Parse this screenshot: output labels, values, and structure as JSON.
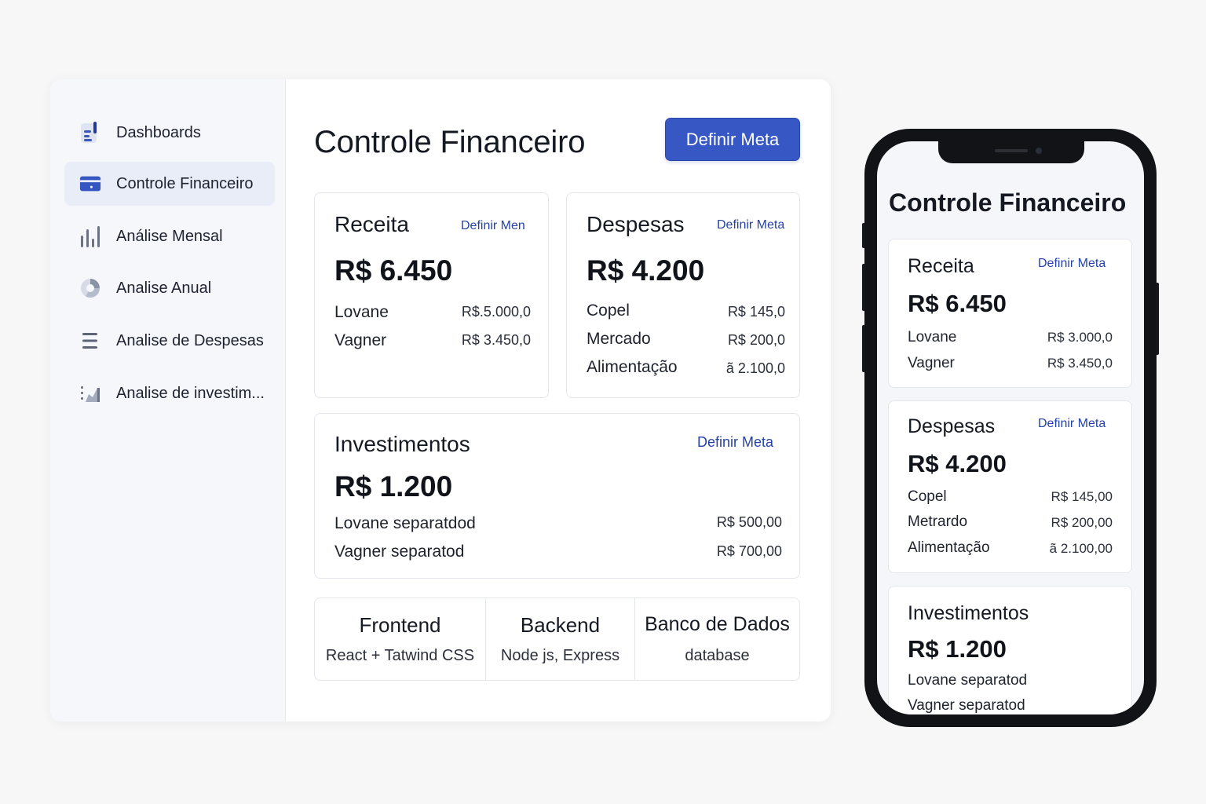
{
  "desktop": {
    "sidebar": {
      "items": [
        {
          "label": "Dashboards",
          "icon": "dashboard-icon",
          "active": false
        },
        {
          "label": "Controle Financeiro",
          "icon": "card-icon",
          "active": true
        },
        {
          "label": "Análise Mensal",
          "icon": "bar-chart-icon",
          "active": false
        },
        {
          "label": "Analise Anual",
          "icon": "pie-chart-icon",
          "active": false
        },
        {
          "label": "Analise de Despesas",
          "icon": "list-icon",
          "active": false
        },
        {
          "label": "Analise de investim...",
          "icon": "area-chart-icon",
          "active": false
        }
      ]
    },
    "main": {
      "title": "Controle Financeiro",
      "goal_button": "Definir Meta",
      "receita": {
        "title": "Receita",
        "link": "Definir Men",
        "amount": "R$ 6.450",
        "rows": [
          {
            "name": "Lovane",
            "value": "R$.5.000,0"
          },
          {
            "name": "Vagner",
            "value": "R$ 3.450,0"
          }
        ]
      },
      "despesas": {
        "title": "Despesas",
        "link": "Definir Meta",
        "amount": "R$ 4.200",
        "rows": [
          {
            "name": "Copel",
            "value": "R$ 145,0"
          },
          {
            "name": "Mercado",
            "value": "R$ 200,0"
          },
          {
            "name": "Alimentação",
            "value": "ã 2.100,0"
          }
        ]
      },
      "investimentos": {
        "title": "Investimentos",
        "link": "Definir Meta",
        "amount": "R$ 1.200",
        "rows": [
          {
            "name": "Lovane separatdod",
            "value": "R$ 500,00"
          },
          {
            "name": "Vagner separatod",
            "value": "R$ 700,00"
          }
        ]
      },
      "tech": [
        {
          "name": "Frontend",
          "desc": "React + Tatwind CSS"
        },
        {
          "name": "Backend",
          "desc": "Node js, Express"
        },
        {
          "name": "Banco de Dados",
          "desc": "database"
        }
      ]
    }
  },
  "mobile": {
    "title": "Controle Financeiro",
    "receita": {
      "title": "Receita",
      "link": "Definir Meta",
      "amount": "R$ 6.450",
      "rows": [
        {
          "name": "Lovane",
          "value": "R$ 3.000,0"
        },
        {
          "name": "Vagner",
          "value": "R$ 3.450,0"
        }
      ]
    },
    "despesas": {
      "title": "Despesas",
      "link": "Definir Meta",
      "amount": "R$ 4.200",
      "rows": [
        {
          "name": "Copel",
          "value": "R$ 145,00"
        },
        {
          "name": "Metrardo",
          "value": "R$ 200,00"
        },
        {
          "name": "Alimentação",
          "value": "ã 2.100,00"
        }
      ]
    },
    "investimentos": {
      "title": "Investimentos",
      "amount": "R$ 1.200",
      "rows": [
        {
          "name": "Lovane separatod"
        },
        {
          "name": "Vagner separatod"
        }
      ]
    }
  },
  "colors": {
    "accent": "#3657c4",
    "link": "#2542a8",
    "sidebar_active": "#e9edf7"
  }
}
